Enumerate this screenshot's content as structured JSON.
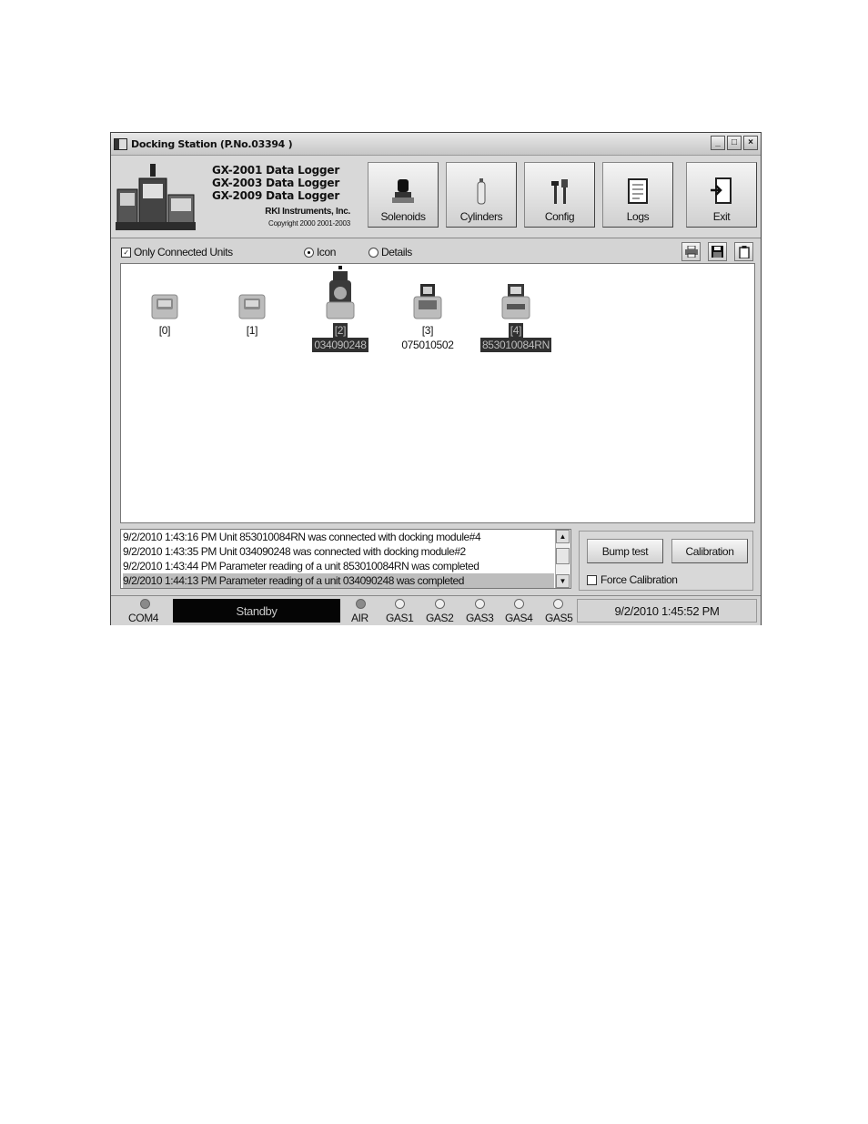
{
  "window": {
    "title": "Docking Station (P.No.03394 )",
    "controls": {
      "minimize": "_",
      "maximize": "□",
      "close": "×"
    }
  },
  "header": {
    "product_lines": [
      "GX-2001 Data Logger",
      "GX-2003 Data Logger",
      "GX-2009 Data Logger"
    ],
    "company": "RKI Instruments, Inc.",
    "copyright": "Copyright 2000 2001-2003",
    "buttons": [
      {
        "label": "Solenoids",
        "icon": "solenoid-icon"
      },
      {
        "label": "Cylinders",
        "icon": "cylinder-icon"
      },
      {
        "label": "Config",
        "icon": "tools-icon"
      },
      {
        "label": "Logs",
        "icon": "log-book-icon"
      },
      {
        "label": "Exit",
        "icon": "exit-door-icon"
      }
    ]
  },
  "options": {
    "only_connected_label": "Only Connected Units",
    "only_connected_checked": true,
    "view_icon_label": "Icon",
    "view_details_label": "Details",
    "view_mode": "Icon",
    "tools": [
      "print-icon",
      "save-icon",
      "clipboard-icon"
    ]
  },
  "units": [
    {
      "slot": "[0]",
      "serial": "",
      "selected": false,
      "device": "dock"
    },
    {
      "slot": "[1]",
      "serial": "",
      "selected": false,
      "device": "dock"
    },
    {
      "slot": "[2]",
      "serial": "034090248",
      "selected": true,
      "device": "gx2001"
    },
    {
      "slot": "[3]",
      "serial": "075010502",
      "selected": false,
      "device": "gx2003"
    },
    {
      "slot": "[4]",
      "serial": "853010084RN",
      "selected": true,
      "device": "gx2009"
    }
  ],
  "log": [
    "9/2/2010 1:43:16 PM Unit 853010084RN was connected with docking module#4",
    "9/2/2010 1:43:35 PM Unit 034090248 was connected with docking module#2",
    "9/2/2010 1:43:44 PM Parameter reading of a unit 853010084RN was completed",
    "9/2/2010 1:44:13 PM Parameter reading of a unit 034090248 was completed"
  ],
  "log_highlight_index": 3,
  "actions": {
    "bump_test_label": "Bump test",
    "calibration_label": "Calibration",
    "force_calibration_label": "Force Calibration",
    "force_calibration_checked": false
  },
  "status": {
    "port_label": "COM4",
    "port_active": true,
    "state": "Standby",
    "gases": [
      {
        "label": "AIR",
        "active": true
      },
      {
        "label": "GAS1",
        "active": false
      },
      {
        "label": "GAS2",
        "active": false
      },
      {
        "label": "GAS3",
        "active": false
      },
      {
        "label": "GAS4",
        "active": false
      },
      {
        "label": "GAS5",
        "active": false
      }
    ],
    "datetime": "9/2/2010 1:45:52 PM"
  }
}
